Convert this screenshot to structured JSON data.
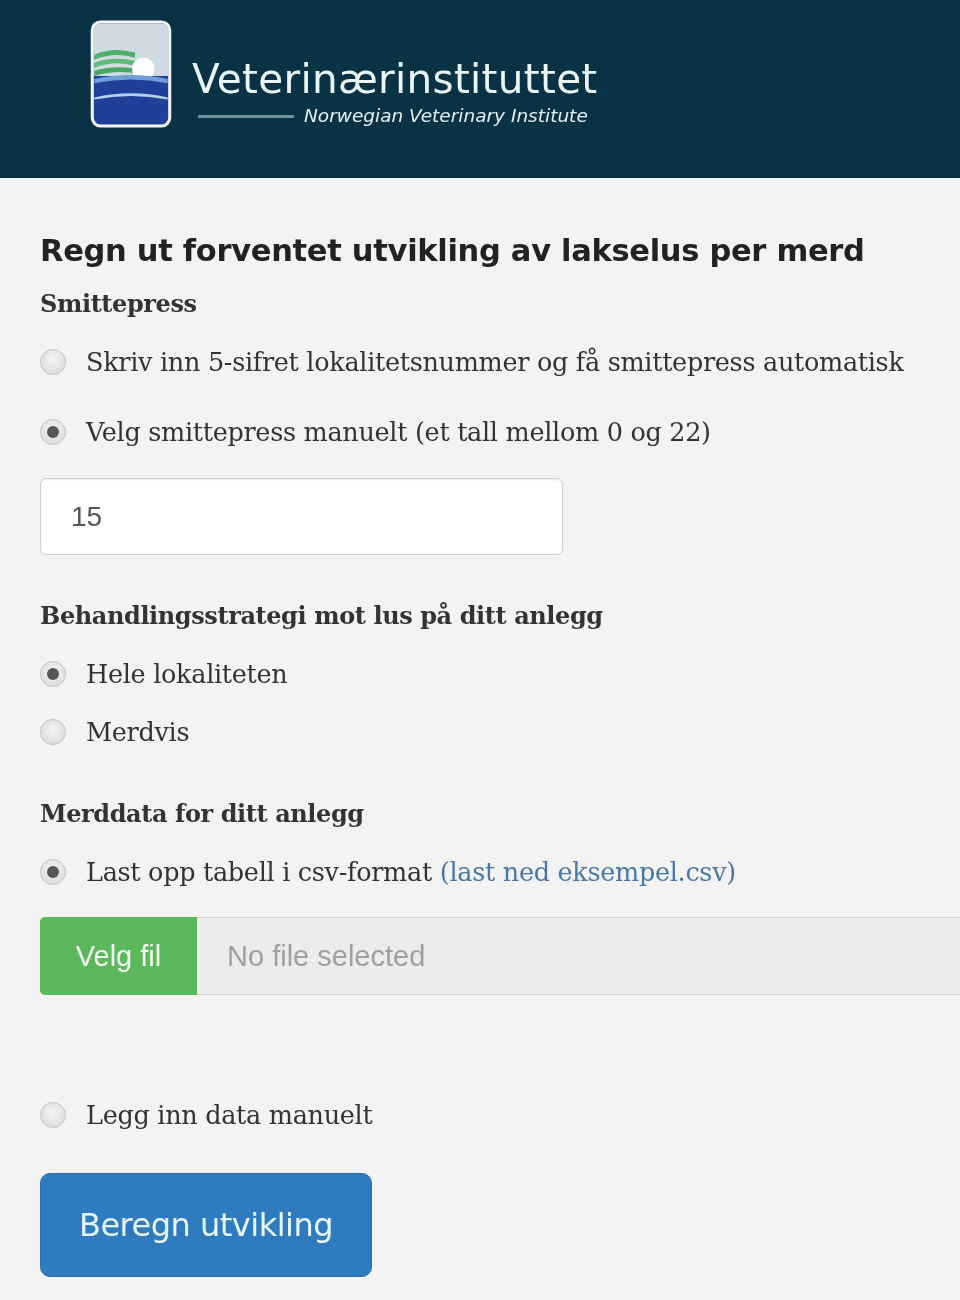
{
  "header": {
    "logo_title": "Veterinærinstituttet",
    "logo_subtitle": "Norwegian Veterinary Institute"
  },
  "heading": "Regn ut forventet utvikling av lakselus per merd",
  "sections": [
    {
      "title": "Smittepress",
      "options": [
        {
          "label": "Skriv inn 5-sifret lokalitetsnummer og få smittepress automatisk",
          "selected": false
        },
        {
          "label": "Velg smittepress manuelt (et tall mellom 0 og 22)",
          "selected": true,
          "field": {
            "kind": "text",
            "value": "15"
          }
        }
      ]
    },
    {
      "title": "Behandlingsstrategi mot lus på ditt anlegg",
      "options": [
        {
          "label": "Hele lokaliteten",
          "selected": true
        },
        {
          "label": "Merdvis",
          "selected": false
        }
      ]
    },
    {
      "title": "Merddata for ditt anlegg",
      "options": [
        {
          "label": "Last opp tabell i csv-format",
          "link": "(last ned eksempel.csv)",
          "selected": true,
          "field": {
            "kind": "file",
            "button": "Velg fil",
            "status": "No file selected"
          }
        },
        {
          "label": "Legg inn data manuelt",
          "selected": false
        }
      ]
    }
  ],
  "submit": {
    "label": "Beregn utvikling"
  }
}
